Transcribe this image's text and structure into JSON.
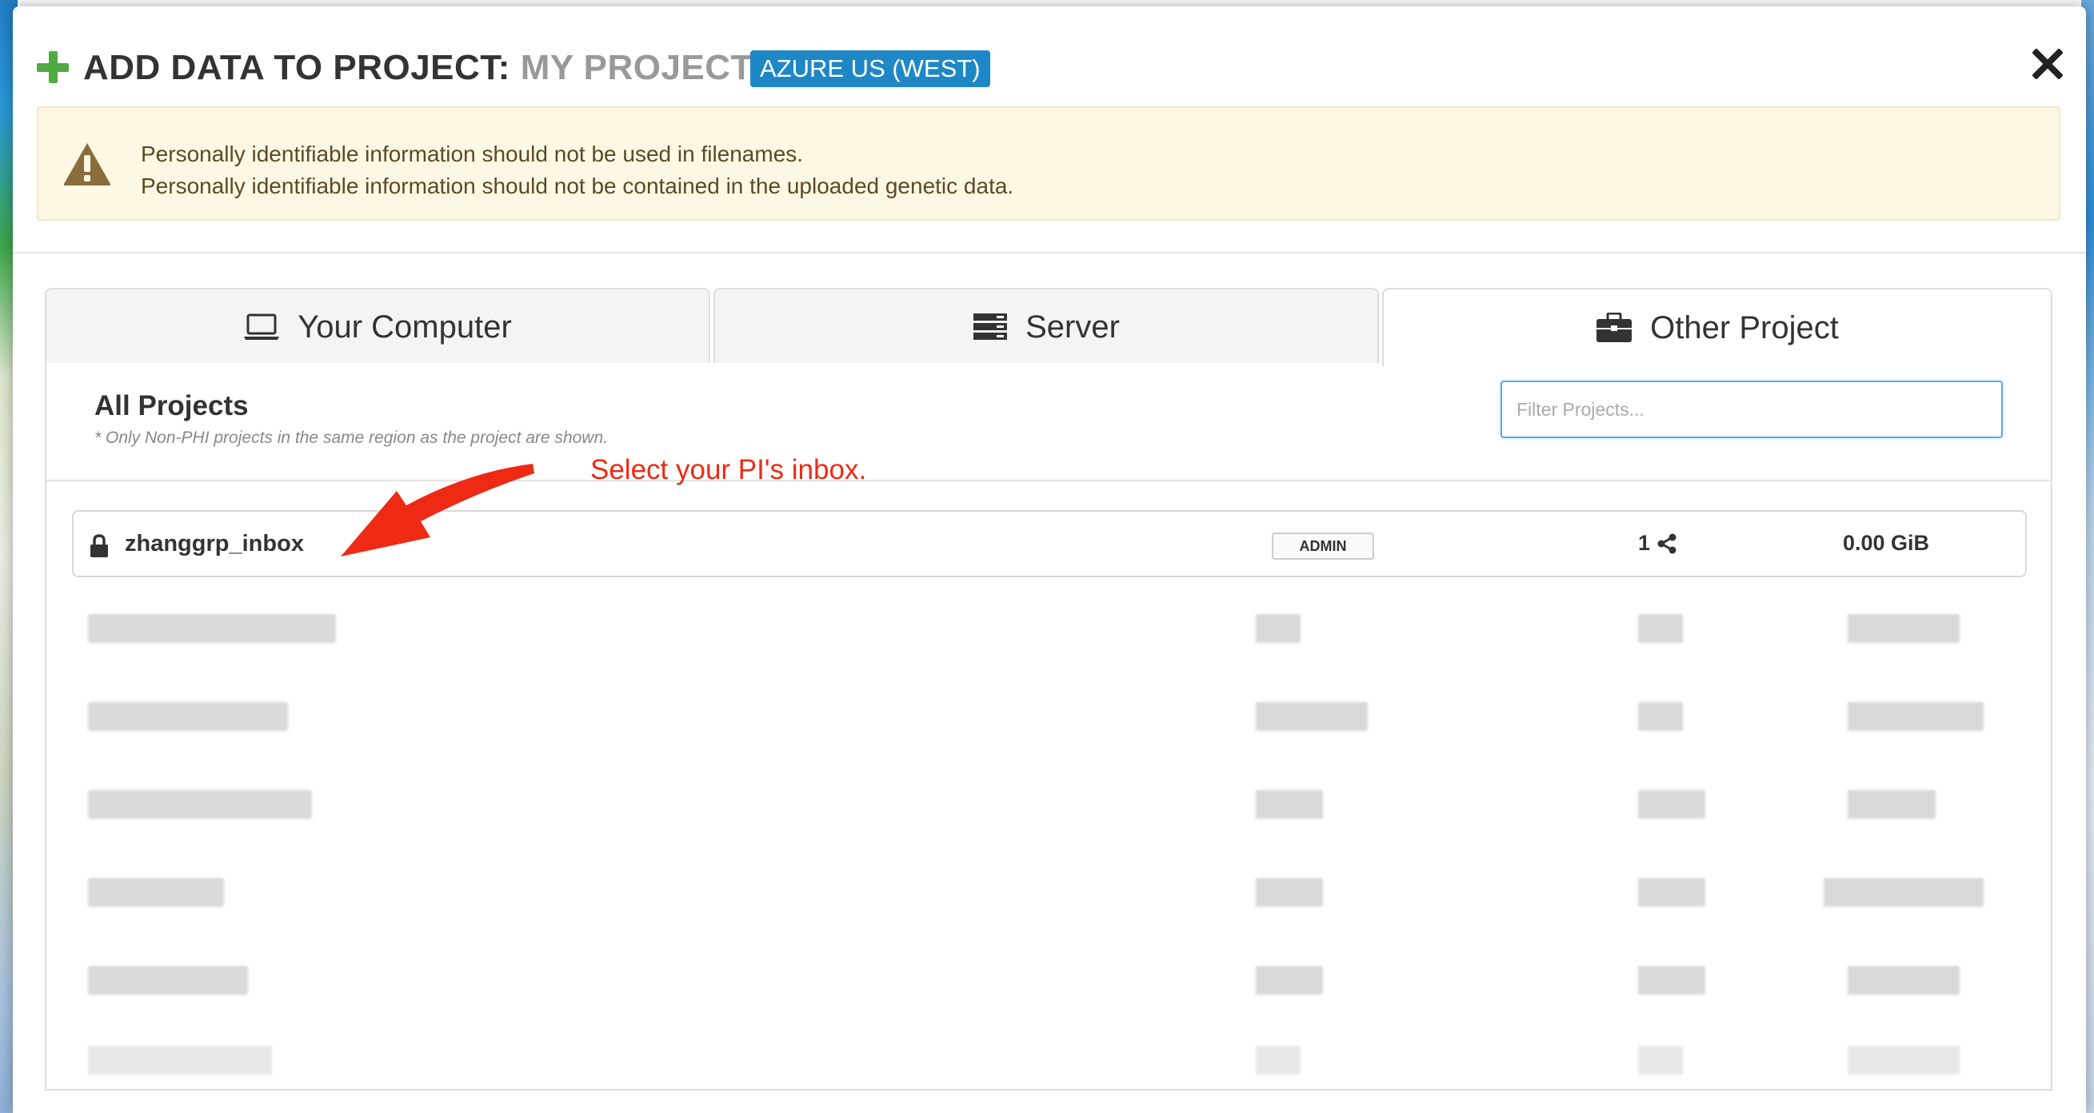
{
  "header": {
    "title_prefix": "ADD DATA TO PROJECT:",
    "project_name": "MY PROJECT",
    "region": "AZURE US (WEST)"
  },
  "warning": {
    "line1": "Personally identifiable information should not be used in filenames.",
    "line2": "Personally identifiable information should not be contained in the uploaded genetic data."
  },
  "tabs": [
    {
      "label": "Your Computer",
      "icon": "laptop-icon",
      "active": false
    },
    {
      "label": "Server",
      "icon": "server-icon",
      "active": false
    },
    {
      "label": "Other Project",
      "icon": "briefcase-icon",
      "active": true
    }
  ],
  "panel": {
    "heading": "All Projects",
    "note": "* Only Non-PHI projects in the same region as the project are shown.",
    "filter_placeholder": "Filter Projects..."
  },
  "projects": [
    {
      "name": "zhanggrp_inbox",
      "role": "ADMIN",
      "members": "1",
      "size": "0.00 GiB",
      "locked": true
    }
  ],
  "annotation": {
    "text": "Select your PI's inbox."
  },
  "colors": {
    "accent_blue": "#1e88c6",
    "plus_green": "#51a941",
    "warning_bg": "#fcf8e3",
    "warning_icon": "#8a6d3b",
    "annotation_red": "#ee2a14"
  }
}
